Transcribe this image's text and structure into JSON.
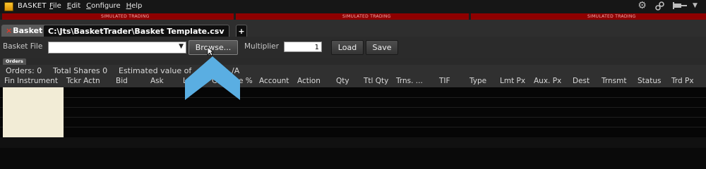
{
  "app": {
    "title": "BASKET"
  },
  "menu": [
    "File",
    "Edit",
    "Configure",
    "Help"
  ],
  "sim_labels": [
    "SIMULATED TRADING",
    "SIMULATED TRADING",
    "SIMULATED TRADING"
  ],
  "tabs": [
    {
      "label": "Basket",
      "close": "×"
    },
    {
      "label": "C:\\Jts\\BasketTrader\\Basket Template.csv"
    },
    {
      "label": "+"
    }
  ],
  "toolbar": {
    "basket_file_label": "Basket File",
    "basket_file_value": "",
    "browse_label": "Browse...",
    "multiplier_label": "Multiplier",
    "multiplier_value": "1",
    "load_label": "Load",
    "save_label": "Save"
  },
  "orders": {
    "panel_label": "Orders",
    "summary": {
      "orders": "Orders: 0",
      "total_shares": "Total Shares 0",
      "estimated": "Estimated value of",
      "estimated_tail": "/A"
    },
    "columns": [
      "Fin Instrument",
      "Tckr Actn",
      "Bid",
      "Ask",
      "L",
      "C",
      "e %",
      "Account",
      "Action",
      "Qty",
      "Ttl Qty",
      "Trns. ...",
      "TIF",
      "Type",
      "Lmt Px",
      "Aux. Px",
      "Dest",
      "Trnsmt",
      "Status",
      "Trd Px"
    ]
  },
  "icons": [
    "gear-icon",
    "link-icon",
    "pin-icon",
    "menu-caret-icon"
  ],
  "colors": {
    "sim_strip": "#8e0000",
    "arrow": "#5aaee2",
    "selected_cell": "#f2ecd6"
  }
}
